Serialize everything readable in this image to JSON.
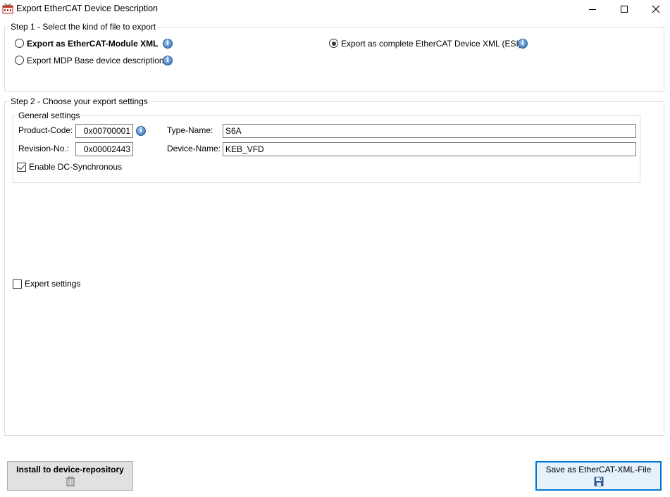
{
  "window": {
    "title": "Export EtherCAT Device Description",
    "controls": {
      "minimize": "minimize-icon",
      "maximize": "maximize-icon",
      "close": "close-icon"
    }
  },
  "step1": {
    "label": "Step 1 - Select the kind of file to export",
    "options": [
      {
        "label": "Export as EtherCAT-Module XML",
        "selected": false,
        "bold": true
      },
      {
        "label": "Export MDP Base device description",
        "selected": false
      },
      {
        "label": "Export as complete EtherCAT Device XML (ESI)",
        "selected": true
      }
    ]
  },
  "step2": {
    "label": "Step 2 - Choose your export settings",
    "general": {
      "label": "General settings",
      "product_code_label": "Product-Code:",
      "product_code_value": "0x00700001",
      "revision_label": "Revision-No.:",
      "revision_value": "0x00002443",
      "type_name_label": "Type-Name:",
      "type_name_value": "S6A",
      "device_name_label": "Device-Name:",
      "device_name_value": "KEB_VFD",
      "dc_sync_label": "Enable DC-Synchronous",
      "dc_sync_checked": true
    },
    "expert_label": "Expert settings",
    "expert_checked": false
  },
  "buttons": {
    "install_label": "Install to device-repository",
    "save_label": "Save as EtherCAT-XML-File"
  },
  "colors": {
    "focus_border": "#0078d7",
    "info_icon": "#4a86c6"
  }
}
